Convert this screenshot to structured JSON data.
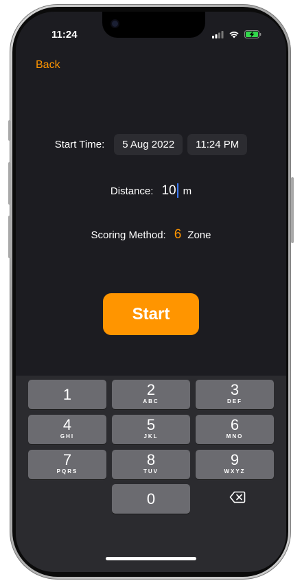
{
  "status_bar": {
    "time": "11:24"
  },
  "nav": {
    "back_label": "Back"
  },
  "start_time": {
    "label": "Start Time:",
    "date": "5 Aug 2022",
    "time": "11:24 PM"
  },
  "distance": {
    "label": "Distance:",
    "value": "10",
    "unit": "m"
  },
  "scoring": {
    "label": "Scoring Method:",
    "value": "6",
    "unit": "Zone"
  },
  "start_button": {
    "label": "Start"
  },
  "keypad": {
    "keys": [
      {
        "digit": "1",
        "letters": ""
      },
      {
        "digit": "2",
        "letters": "ABC"
      },
      {
        "digit": "3",
        "letters": "DEF"
      },
      {
        "digit": "4",
        "letters": "GHI"
      },
      {
        "digit": "5",
        "letters": "JKL"
      },
      {
        "digit": "6",
        "letters": "MNO"
      },
      {
        "digit": "7",
        "letters": "PQRS"
      },
      {
        "digit": "8",
        "letters": "TUV"
      },
      {
        "digit": "9",
        "letters": "WXYZ"
      },
      {
        "digit": "0",
        "letters": ""
      }
    ]
  },
  "colors": {
    "accent": "#ff9500",
    "background": "#1c1c21",
    "key": "#6b6b70",
    "keyboard": "#2b2b2f",
    "caret": "#3d7bfd"
  }
}
